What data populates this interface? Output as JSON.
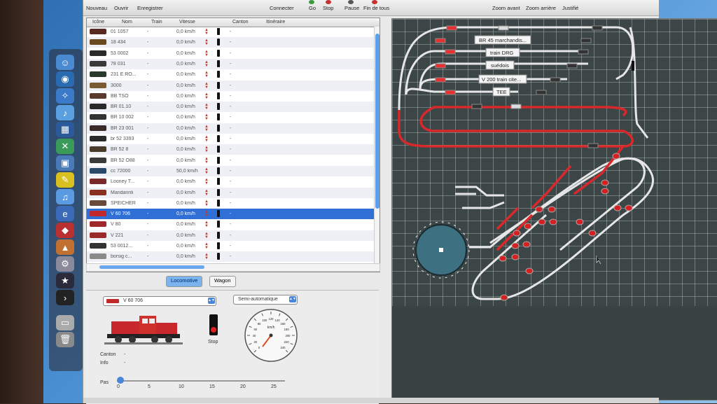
{
  "toolbar": {
    "new": "Nouveau",
    "open": "Ouvrir",
    "save": "Enregistrer",
    "connect": "Connecter",
    "go": "Go",
    "stop": "Stop",
    "pause": "Pause",
    "finish_all": "Fin de tous",
    "zoom_in": "Zoom avant",
    "zoom_out": "Zoom arrière",
    "justify": "Justifié"
  },
  "table": {
    "headers": [
      "Icône",
      "Nom",
      "Train",
      "Vitesse",
      "Canton",
      "Itinéraire"
    ],
    "rows": [
      {
        "name": "01 1057",
        "train": "-",
        "speed": "0,0 km/h",
        "canton": "-",
        "loco_color": "#5a2a20"
      },
      {
        "name": "18 434",
        "train": "-",
        "speed": "0,0 km/h",
        "canton": "-",
        "loco_color": "#6b4a22"
      },
      {
        "name": "53 0002",
        "train": "-",
        "speed": "0,0 km/h",
        "canton": "-",
        "loco_color": "#2a2a2a"
      },
      {
        "name": "78 031",
        "train": "-",
        "speed": "0,0 km/h",
        "canton": "-",
        "loco_color": "#3a3a3a"
      },
      {
        "name": "231 E RO...",
        "train": "-",
        "speed": "0,0 km/h",
        "canton": "-",
        "loco_color": "#2a3a2a"
      },
      {
        "name": "3000",
        "train": "-",
        "speed": "0,0 km/h",
        "canton": "-",
        "loco_color": "#7a5a30"
      },
      {
        "name": "BB TSO",
        "train": "-",
        "speed": "0,0 km/h",
        "canton": "-",
        "loco_color": "#5a3a2a"
      },
      {
        "name": "BR 01.10",
        "train": "-",
        "speed": "0,0 km/h",
        "canton": "-",
        "loco_color": "#2a2a2a"
      },
      {
        "name": "BR 10 002",
        "train": "-",
        "speed": "0,0 km/h",
        "canton": "-",
        "loco_color": "#333"
      },
      {
        "name": "BR 23 001",
        "train": "-",
        "speed": "0,0 km/h",
        "canton": "-",
        "loco_color": "#3a2a2a"
      },
      {
        "name": "br 52 3393",
        "train": "-",
        "speed": "0,0 km/h",
        "canton": "-",
        "loco_color": "#2a2a2a"
      },
      {
        "name": "BR 52  8",
        "train": "-",
        "speed": "0,0 km/h",
        "canton": "-",
        "loco_color": "#4a3a2a"
      },
      {
        "name": "BR 52  O88",
        "train": "-",
        "speed": "0,0 km/h",
        "canton": "-",
        "loco_color": "#3a3a3a"
      },
      {
        "name": "cc 72000",
        "train": "-",
        "speed": "50,0 km/h",
        "canton": "-",
        "loco_color": "#2a4a6a"
      },
      {
        "name": "Looney T...",
        "train": "-",
        "speed": "0,0 km/h",
        "canton": "-",
        "loco_color": "#7a2a2a"
      },
      {
        "name": "Mandarinli",
        "train": "-",
        "speed": "0,0 km/h",
        "canton": "-",
        "loco_color": "#8a3020"
      },
      {
        "name": "SPEICHER",
        "train": "-",
        "speed": "0,0 km/h",
        "canton": "-",
        "loco_color": "#6a4a3a"
      },
      {
        "name": "V 60 706",
        "train": "-",
        "speed": "0,0 km/h",
        "canton": "-",
        "loco_color": "#c0282a"
      },
      {
        "name": "V 80",
        "train": "-",
        "speed": "0,0 km/h",
        "canton": "-",
        "loco_color": "#a02a2a"
      },
      {
        "name": "V 221",
        "train": "-",
        "speed": "0,0 km/h",
        "canton": "-",
        "loco_color": "#9a2a2a"
      },
      {
        "name": "53 0012...",
        "train": "-",
        "speed": "0,0 km/h",
        "canton": "-",
        "loco_color": "#333"
      },
      {
        "name": "borsig c...",
        "train": "-",
        "speed": "0,0 km/h",
        "canton": "-",
        "loco_color": "#8a8a8a"
      }
    ]
  },
  "tabs": {
    "locomotive": "Locomotive",
    "wagon": "Wagon"
  },
  "panel": {
    "loco_select": "V 60 706",
    "mode_select": "Semi-automatique",
    "stop_label": "Stop",
    "canton_label": "Canton",
    "canton_value": "-",
    "info_label": "Info",
    "info_value": "-",
    "pas_label": "Pas",
    "slider_ticks": [
      "0",
      "5",
      "10",
      "15",
      "20",
      "25"
    ],
    "speedo_unit": "km/h",
    "speedo_ticks": [
      "0",
      "20",
      "40",
      "60",
      "80",
      "100",
      "120",
      "140",
      "160",
      "180",
      "200",
      "220",
      "240"
    ]
  },
  "layout": {
    "labels": [
      "BR 45 marchandis...",
      "train DRG",
      "suédois",
      "V 200 train cite...",
      "TEE"
    ]
  }
}
